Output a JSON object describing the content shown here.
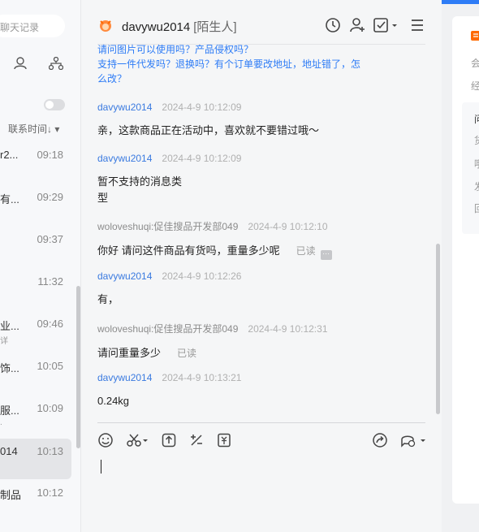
{
  "sidebar": {
    "search_placeholder": "聊天记录",
    "sort_label": "联系时间↓ ▾",
    "conversations": [
      {
        "name": "r2...",
        "time": "09:18",
        "sub": ""
      },
      {
        "name": "有...",
        "time": "09:29",
        "sub": ""
      },
      {
        "name": "",
        "time": "09:37",
        "sub": ""
      },
      {
        "name": "",
        "time": "11:32",
        "sub": ""
      },
      {
        "name": "业...",
        "time": "09:46",
        "sub": "详"
      },
      {
        "name": "饰...",
        "time": "10:05",
        "sub": ""
      },
      {
        "name": "服...",
        "time": "10:09",
        "sub": "."
      },
      {
        "name": "014",
        "time": "10:13",
        "sub": "",
        "active": true
      },
      {
        "name": "制品",
        "time": "10:12",
        "sub": ""
      }
    ]
  },
  "chat": {
    "contact_name": "davywu2014",
    "contact_tag": "[陌生人]",
    "faq": [
      "请问图片可以使用吗？产品侵权吗？",
      "支持一件代发吗？退换吗？有个订单要改地址，地址错了，怎",
      "么改？"
    ],
    "messages": [
      {
        "sender": "davywu2014",
        "time": "2024-4-9 10:12:09",
        "lines": [
          "亲，这款商品正在活动中，喜欢就不要错过哦～"
        ],
        "role": "seller"
      },
      {
        "sender": "davywu2014",
        "time": "2024-4-9 10:12:09",
        "lines": [
          "暂不支持的消息类",
          "型"
        ],
        "role": "seller"
      },
      {
        "sender": "woloveshuqi:促佳搜品开发部049",
        "time": "2024-4-9 10:12:10",
        "lines": [
          "你好 请问这件商品有货吗，重量多少呢"
        ],
        "role": "buyer",
        "status": "已读"
      },
      {
        "sender": "davywu2014",
        "time": "2024-4-9 10:12:26",
        "lines": [
          "有，"
        ],
        "role": "seller"
      },
      {
        "sender": "woloveshuqi:促佳搜品开发部049",
        "time": "2024-4-9 10:12:31",
        "lines": [
          "请问重量多少"
        ],
        "role": "buyer",
        "status": "已读"
      },
      {
        "sender": "davywu2014",
        "time": "2024-4-9 10:13:21",
        "lines": [
          "0.24kg"
        ],
        "role": "seller"
      }
    ]
  },
  "right_panel": {
    "rows": [
      "会",
      "经"
    ],
    "inner_rows": [
      "问",
      "货",
      "哦",
      "发",
      "回"
    ]
  },
  "colors": {
    "accent": "#2e7cf6",
    "brand_orange": "#ff6a00"
  }
}
